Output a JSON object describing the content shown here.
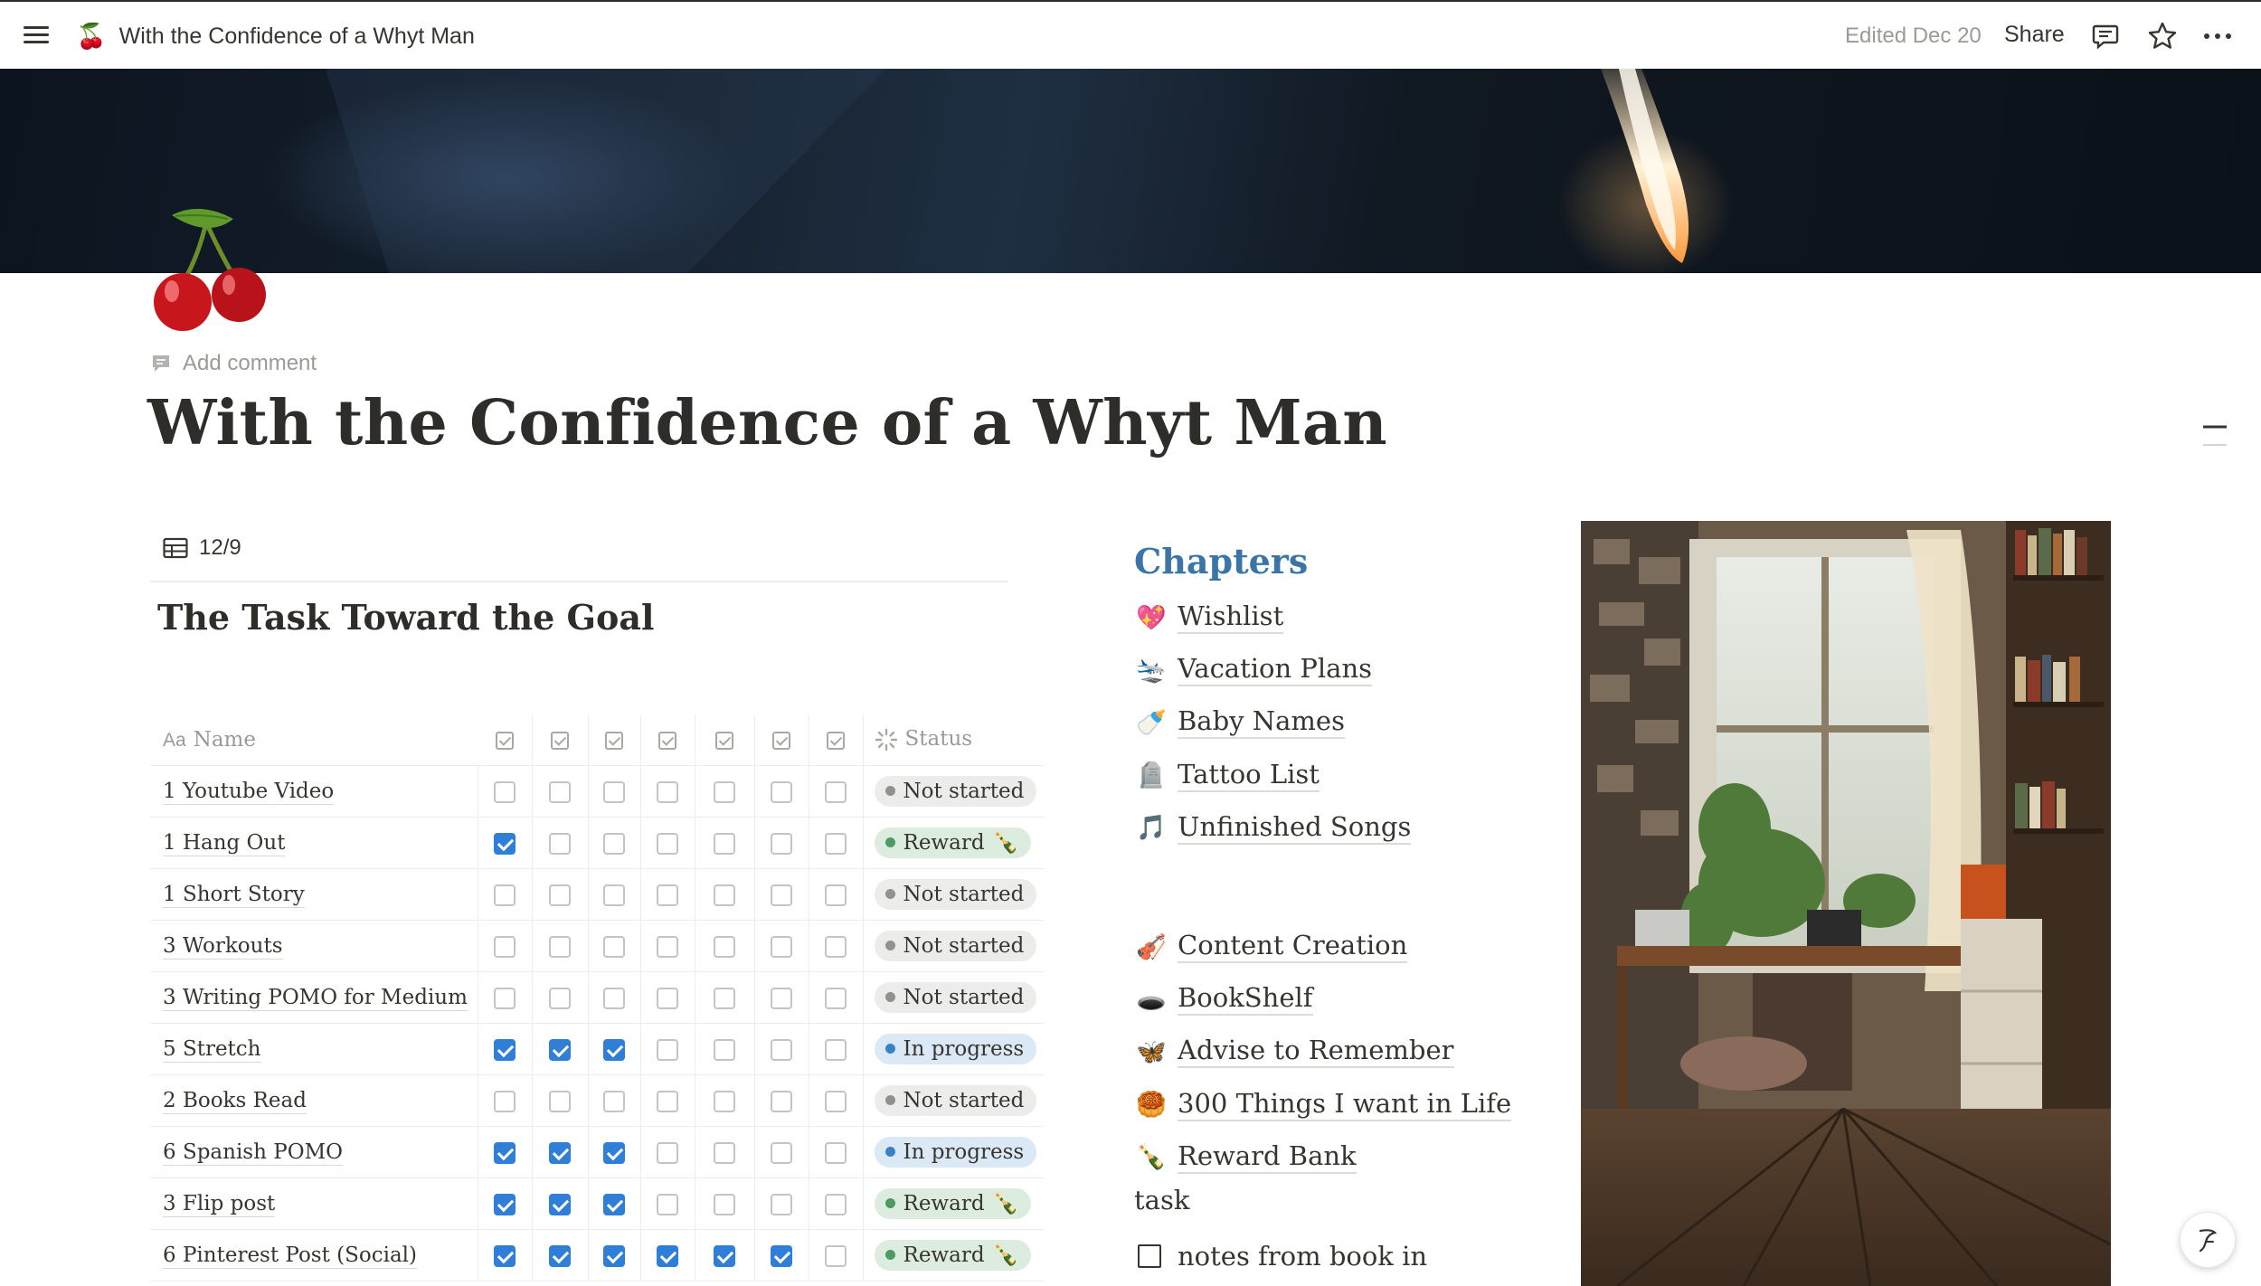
{
  "topbar": {
    "breadcrumb_icon": "🍒",
    "breadcrumb_title": "With the Confidence of a Whyt Man",
    "edited": "Edited Dec 20",
    "share": "Share",
    "icons": [
      "menu-icon",
      "comment-icon",
      "star-icon",
      "more-icon"
    ]
  },
  "cover": {
    "description_icon": "cover-image"
  },
  "page": {
    "add_comment": "Add comment",
    "title": "With the Confidence of a Whyt Man"
  },
  "database": {
    "view_name": "12/9",
    "title": "The Task Toward the Goal",
    "name_col_prefix": "Aa",
    "name_col": "Name",
    "status_col": "Status",
    "checkbox_cols": 7,
    "rows": [
      {
        "name": "1 Youtube Video",
        "checks": [
          false,
          false,
          false,
          false,
          false,
          false,
          false
        ],
        "status": "Not started",
        "status_type": "ns",
        "status_emoji": ""
      },
      {
        "name": "1 Hang Out",
        "checks": [
          true,
          false,
          false,
          false,
          false,
          false,
          false
        ],
        "status": "Reward",
        "status_type": "rw",
        "status_emoji": "🍾"
      },
      {
        "name": "1 Short Story",
        "checks": [
          false,
          false,
          false,
          false,
          false,
          false,
          false
        ],
        "status": "Not started",
        "status_type": "ns",
        "status_emoji": ""
      },
      {
        "name": "3 Workouts",
        "checks": [
          false,
          false,
          false,
          false,
          false,
          false,
          false
        ],
        "status": "Not started",
        "status_type": "ns",
        "status_emoji": ""
      },
      {
        "name": "3 Writing POMO for Medium",
        "checks": [
          false,
          false,
          false,
          false,
          false,
          false,
          false
        ],
        "status": "Not started",
        "status_type": "ns",
        "status_emoji": ""
      },
      {
        "name": "5 Stretch",
        "checks": [
          true,
          true,
          true,
          false,
          false,
          false,
          false
        ],
        "status": "In progress",
        "status_type": "ip",
        "status_emoji": ""
      },
      {
        "name": "2 Books Read",
        "checks": [
          false,
          false,
          false,
          false,
          false,
          false,
          false
        ],
        "status": "Not started",
        "status_type": "ns",
        "status_emoji": ""
      },
      {
        "name": "6 Spanish POMO",
        "checks": [
          true,
          true,
          true,
          false,
          false,
          false,
          false
        ],
        "status": "In progress",
        "status_type": "ip",
        "status_emoji": ""
      },
      {
        "name": "3 Flip post",
        "checks": [
          true,
          true,
          true,
          false,
          false,
          false,
          false
        ],
        "status": "Reward",
        "status_type": "rw",
        "status_emoji": "🍾"
      },
      {
        "name": "6 Pinterest Post (Social)",
        "checks": [
          true,
          true,
          true,
          true,
          true,
          true,
          false
        ],
        "status": "Reward",
        "status_type": "rw",
        "status_emoji": "🍾"
      }
    ]
  },
  "chapters": {
    "heading": "Chapters",
    "group1": [
      {
        "icon": "💖",
        "label": "Wishlist"
      },
      {
        "icon": "🛬",
        "label": "Vacation Plans"
      },
      {
        "icon": "🍼",
        "label": "Baby Names"
      },
      {
        "icon": "🪦",
        "label": "Tattoo List"
      },
      {
        "icon": "🎵",
        "label": "Unfinished Songs"
      }
    ],
    "group2": [
      {
        "icon": "🎻",
        "label": "Content Creation"
      },
      {
        "icon": "🕳️",
        "label": "BookShelf"
      },
      {
        "icon": "🦋",
        "label": "Advise to Remember"
      },
      {
        "icon": "🥮",
        "label": "300 Things I want in Life"
      },
      {
        "icon": "🍾",
        "label": "Reward Bank"
      }
    ],
    "task_label": "task",
    "todo_text": "notes from book in",
    "todo_checked": false
  },
  "photo": {
    "icon": "room-photo"
  }
}
